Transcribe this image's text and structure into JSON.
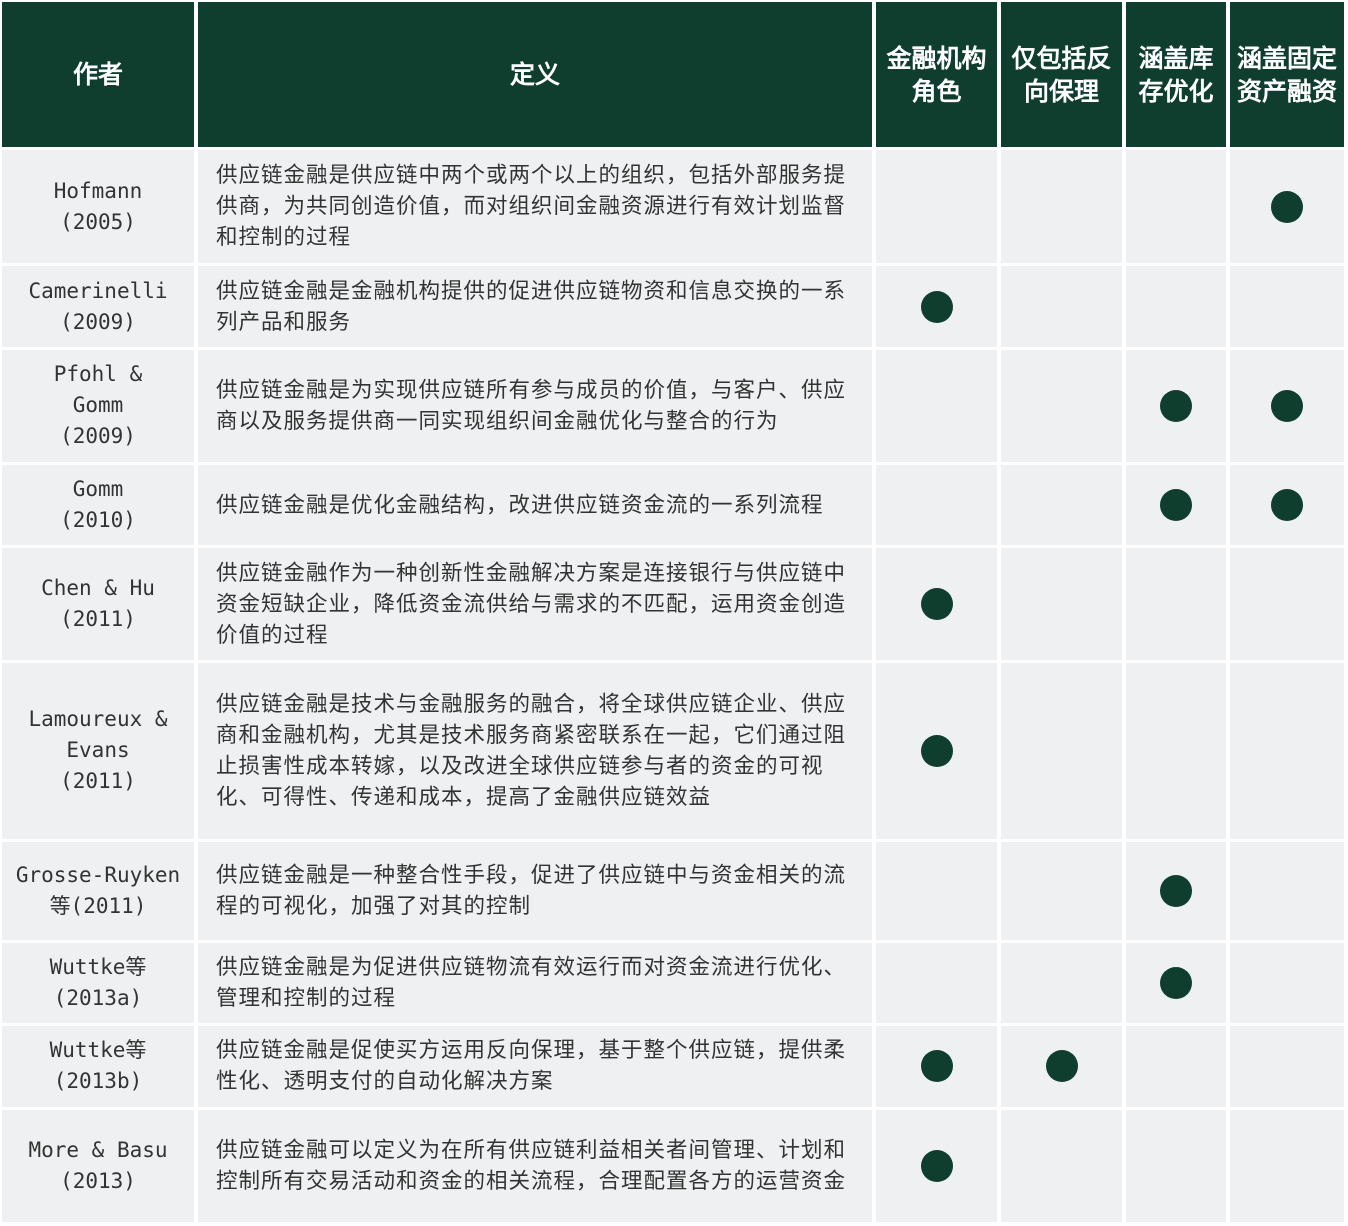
{
  "colors": {
    "header_bg": "#0f3d2e",
    "row_bg": "#eef0f1",
    "dot": "#0f3d2e"
  },
  "header": {
    "author": "作者",
    "definition": "定义",
    "cols": [
      "金融机构角色",
      "仅包括反向保理",
      "涵盖库存优化",
      "涵盖固定资产融资"
    ]
  },
  "rows": [
    {
      "author": [
        "Hofmann",
        "(2005)"
      ],
      "definition": "供应链金融是供应链中两个或两个以上的组织，包括外部服务提供商，为共同创造价值，而对组织间金融资源进行有效计划监督和控制的过程",
      "marks": [
        false,
        false,
        false,
        true
      ]
    },
    {
      "author": [
        "Camerinelli",
        "(2009)"
      ],
      "definition": "供应链金融是金融机构提供的促进供应链物资和信息交换的一系列产品和服务",
      "marks": [
        true,
        false,
        false,
        false
      ]
    },
    {
      "author": [
        "Pfohl &",
        "Gomm",
        "(2009)"
      ],
      "definition": "供应链金融是为实现供应链所有参与成员的价值，与客户、供应商以及服务提供商一同实现组织间金融优化与整合的行为",
      "marks": [
        false,
        false,
        true,
        true
      ]
    },
    {
      "author": [
        "Gomm",
        "(2010)"
      ],
      "definition": "供应链金融是优化金融结构，改进供应链资金流的一系列流程",
      "marks": [
        false,
        false,
        true,
        true
      ]
    },
    {
      "author": [
        "Chen & Hu",
        "(2011)"
      ],
      "definition": "供应链金融作为一种创新性金融解决方案是连接银行与供应链中资金短缺企业，降低资金流供给与需求的不匹配，运用资金创造价值的过程",
      "marks": [
        true,
        false,
        false,
        false
      ]
    },
    {
      "author": [
        "Lamoureux &",
        "Evans",
        "(2011)"
      ],
      "definition": "供应链金融是技术与金融服务的融合，将全球供应链企业、供应商和金融机构，尤其是技术服务商紧密联系在一起，它们通过阻止损害性成本转嫁，以及改进全球供应链参与者的资金的可视化、可得性、传递和成本，提高了金融供应链效益",
      "marks": [
        true,
        false,
        false,
        false
      ]
    },
    {
      "author": [
        "Grosse-Ruyken",
        "等(2011)"
      ],
      "definition": "供应链金融是一种整合性手段，促进了供应链中与资金相关的流程的可视化，加强了对其的控制",
      "marks": [
        false,
        false,
        true,
        false
      ]
    },
    {
      "author": [
        "Wuttke等",
        "(2013a)"
      ],
      "definition": "供应链金融是为促进供应链物流有效运行而对资金流进行优化、管理和控制的过程",
      "marks": [
        false,
        false,
        true,
        false
      ]
    },
    {
      "author": [
        "Wuttke等",
        "(2013b)"
      ],
      "definition": "供应链金融是促使买方运用反向保理，基于整个供应链，提供柔性化、透明支付的自动化解决方案",
      "marks": [
        true,
        true,
        false,
        false
      ]
    },
    {
      "author": [
        "More & Basu",
        "(2013)"
      ],
      "definition": "供应链金融可以定义为在所有供应链利益相关者间管理、计划和控制所有交易活动和资金的相关流程，合理配置各方的运营资金",
      "marks": [
        true,
        false,
        false,
        false
      ]
    }
  ]
}
